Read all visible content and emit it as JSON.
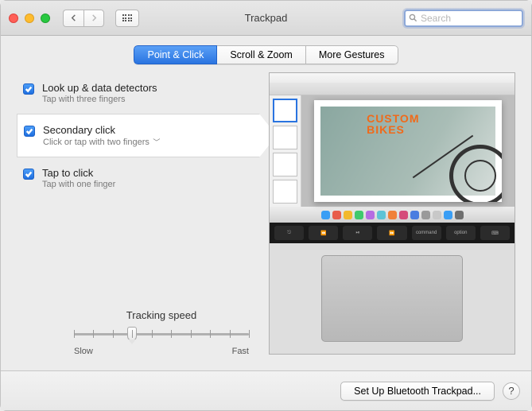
{
  "window": {
    "title": "Trackpad"
  },
  "search": {
    "placeholder": "Search"
  },
  "tabs": [
    {
      "label": "Point & Click",
      "active": true
    },
    {
      "label": "Scroll & Zoom",
      "active": false
    },
    {
      "label": "More Gestures",
      "active": false
    }
  ],
  "options": [
    {
      "title": "Look up & data detectors",
      "desc": "Tap with three fingers",
      "checked": true,
      "has_dropdown": false
    },
    {
      "title": "Secondary click",
      "desc": "Click or tap with two fingers",
      "checked": true,
      "has_dropdown": true
    },
    {
      "title": "Tap to click",
      "desc": "Tap with one finger",
      "checked": true,
      "has_dropdown": false
    }
  ],
  "tracking_speed": {
    "label": "Tracking speed",
    "min_label": "Slow",
    "max_label": "Fast",
    "ticks": 10,
    "value": 3
  },
  "preview": {
    "doc_overlay_line1": "CUSTOM",
    "doc_overlay_line2": "BIKES",
    "touchbar_keys": [
      "⎋",
      "⏪",
      "⏯",
      "⏩",
      "command",
      "option",
      "⌨"
    ]
  },
  "footer": {
    "setup_button": "Set Up Bluetooth Trackpad...",
    "help": "?"
  }
}
